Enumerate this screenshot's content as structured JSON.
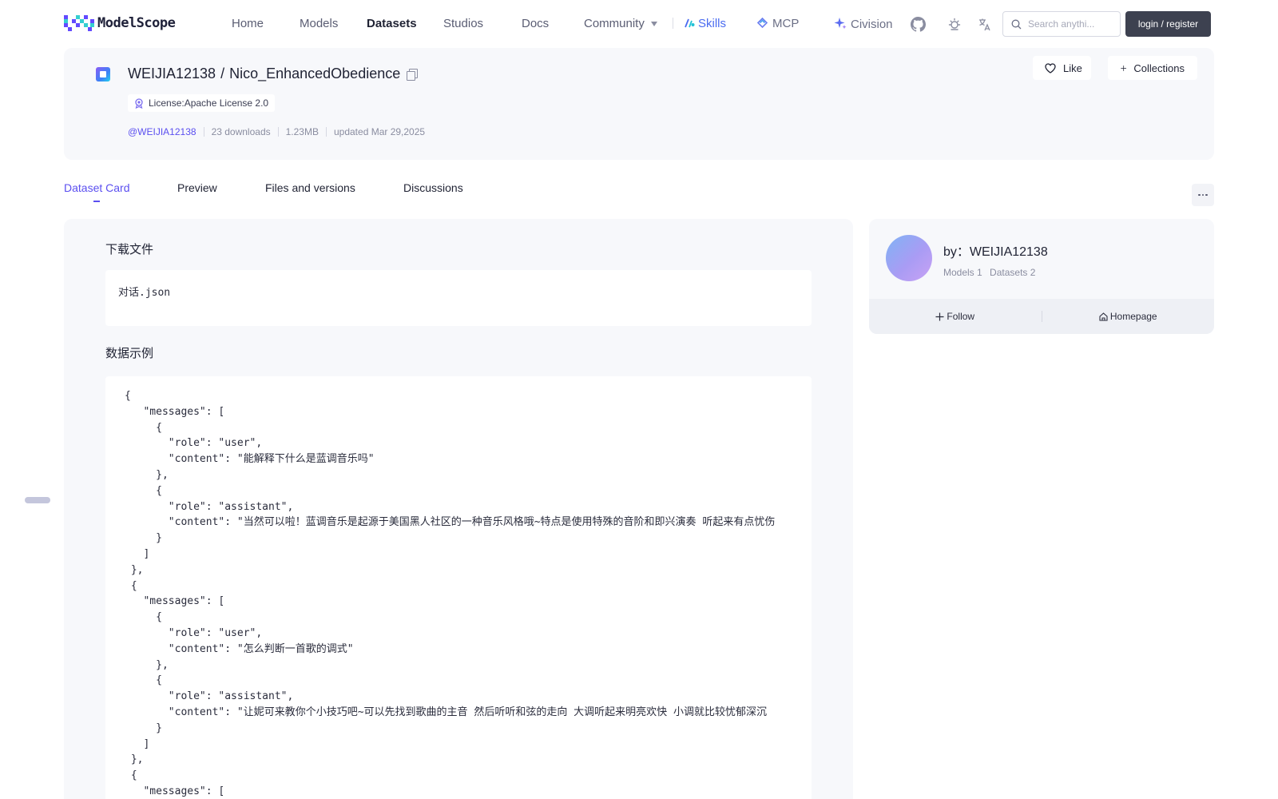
{
  "nav": {
    "logo_text": "ModelScope",
    "items": [
      {
        "label": "Home"
      },
      {
        "label": "Models"
      },
      {
        "label": "Datasets"
      },
      {
        "label": "Studios"
      },
      {
        "label": "Docs"
      },
      {
        "label": "Community"
      },
      {
        "label": "Skills"
      },
      {
        "label": "MCP"
      },
      {
        "label": "Civision"
      }
    ],
    "search_placeholder": "Search anythi...",
    "login_label": "login / register",
    "icons": [
      "github-icon",
      "theme-sun-icon",
      "language-icon",
      "search-icon"
    ]
  },
  "dataset": {
    "owner": "WEIJIA12138",
    "name": "Nico_EnhancedObedience",
    "license": "License:Apache License 2.0",
    "author_link": "@WEIJIA12138",
    "downloads": "23 downloads",
    "size": "1.23MB",
    "updated": "updated Mar 29,2025",
    "like_label": "Like",
    "collections_label": "Collections"
  },
  "tabs": [
    {
      "label": "Dataset Card"
    },
    {
      "label": "Preview"
    },
    {
      "label": "Files and versions"
    },
    {
      "label": "Discussions"
    }
  ],
  "card": {
    "download_title": "下载文件",
    "file_name": "对话.json",
    "example_title": "数据示例",
    "code_lines": [
      "{",
      "   \"messages\": [",
      "     {",
      "       \"role\": \"user\",",
      "       \"content\": \"能解释下什么是蓝调音乐吗\"",
      "     },",
      "     {",
      "       \"role\": \"assistant\",",
      "       \"content\": \"当然可以啦！蓝调音乐是起源于美国黑人社区的一种音乐风格哦~特点是使用特殊的音阶和即兴演奏 听起来有点忧伤",
      "     }",
      "   ]",
      " },",
      " {",
      "   \"messages\": [",
      "     {",
      "       \"role\": \"user\",",
      "       \"content\": \"怎么判断一首歌的调式\"",
      "     },",
      "     {",
      "       \"role\": \"assistant\",",
      "       \"content\": \"让妮可来教你个小技巧吧~可以先找到歌曲的主音 然后听听和弦的走向 大调听起来明亮欢快 小调就比较忧郁深沉",
      "     }",
      "   ]",
      " },",
      " {",
      "   \"messages\": ["
    ]
  },
  "author_card": {
    "by": "by：WEIJIA12138",
    "models": "Models 1",
    "datasets": "Datasets 2",
    "follow_label": "Follow",
    "homepage_label": "Homepage"
  },
  "colors": {
    "accent": "#5b4ff0",
    "card_bg": "#f7f8fb",
    "login_bg": "#3d4150",
    "skills": "#4a6bf0"
  }
}
